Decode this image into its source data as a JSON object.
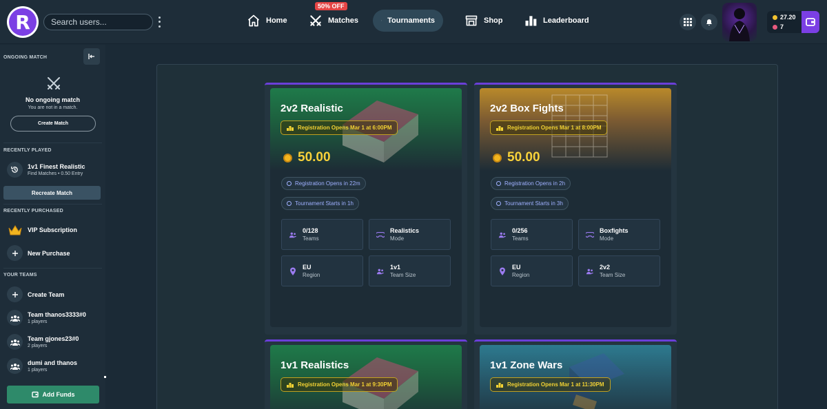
{
  "header": {
    "logo_letter": "R",
    "search_placeholder": "Search users...",
    "nav": [
      {
        "label": "Home",
        "icon": "home-icon"
      },
      {
        "label": "Matches",
        "icon": "crossed-swords-icon",
        "badge": "50% OFF"
      },
      {
        "label": "Tournaments",
        "icon": "trophy-icon"
      },
      {
        "label": "Shop",
        "icon": "shop-icon"
      },
      {
        "label": "Leaderboard",
        "icon": "leaderboard-icon"
      }
    ],
    "wallet": {
      "coins": "27.20",
      "gems": "7"
    }
  },
  "sidebar": {
    "ongoing_title": "ONGOING MATCH",
    "no_match_title": "No ongoing match",
    "no_match_sub": "You are not in a match.",
    "create_match": "Create Match",
    "recently_played_title": "RECENTLY PLAYED",
    "recent_match": {
      "title": "1v1 Finest Realistic",
      "sub": "Find Matches • 0.50 Entry"
    },
    "recreate_match": "Recreate Match",
    "recently_purchased_title": "RECENTLY PURCHASED",
    "vip": "VIP Subscription",
    "new_purchase": "New Purchase",
    "your_teams_title": "YOUR TEAMS",
    "create_team": "Create Team",
    "teams": [
      {
        "name": "Team thanos3333#0",
        "players": "1 players"
      },
      {
        "name": "Team gjones23#0",
        "players": "2 players"
      },
      {
        "name": "dumi and thanos",
        "players": "1 players"
      }
    ],
    "add_funds": "Add Funds"
  },
  "tournaments": [
    {
      "title": "2v2 Realistic",
      "theme": "green",
      "registration": "Registration Opens Mar 1 at 6:00PM",
      "prize": "50.00",
      "reg_opens_in": "Registration Opens in 22m",
      "starts_in": "Tournament Starts in 1h",
      "teams": "0/128",
      "teams_label": "Teams",
      "mode": "Realistics",
      "mode_label": "Mode",
      "region": "EU",
      "region_label": "Region",
      "team_size": "1v1",
      "team_size_label": "Team Size"
    },
    {
      "title": "2v2 Box Fights",
      "theme": "orange",
      "registration": "Registration Opens Mar 1 at 8:00PM",
      "prize": "50.00",
      "reg_opens_in": "Registration Opens in 2h",
      "starts_in": "Tournament Starts in 3h",
      "teams": "0/256",
      "teams_label": "Teams",
      "mode": "Boxfights",
      "mode_label": "Mode",
      "region": "EU",
      "region_label": "Region",
      "team_size": "2v2",
      "team_size_label": "Team Size"
    },
    {
      "title": "1v1 Realistics",
      "theme": "green",
      "registration": "Registration Opens Mar 1 at 9:30PM"
    },
    {
      "title": "1v1 Zone Wars",
      "theme": "blue",
      "registration": "Registration Opens Mar 1 at 11:30PM"
    }
  ]
}
